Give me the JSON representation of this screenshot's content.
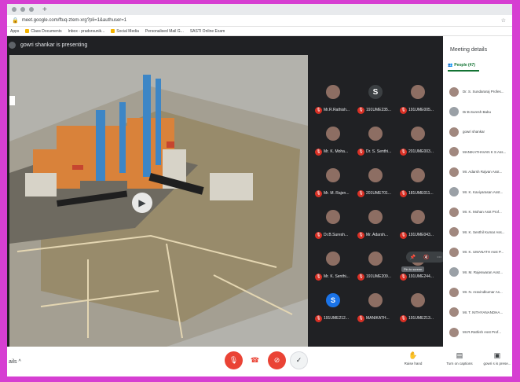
{
  "browser": {
    "url": "meet.google.com/ftuq-ztem-xrg?pli=1&authuser=1",
    "bookmarks": [
      "Apps",
      "Class Documents",
      "Inbox - pradsrsunik...",
      "Social Media",
      "Personalised Mail G...",
      "SASTI Online Exam"
    ]
  },
  "meeting": {
    "presenter_text": "gowri shankar is presenting"
  },
  "tiles": [
    {
      "name": "Mr.R.Rathish...",
      "avatar": "photo"
    },
    {
      "name": "191UME235...",
      "avatar": "letter",
      "letter": "S"
    },
    {
      "name": "191UME005...",
      "avatar": "photo"
    },
    {
      "name": "Mr. K. Moha...",
      "avatar": "photo"
    },
    {
      "name": "Dr. S. Senthi...",
      "avatar": "photo"
    },
    {
      "name": "201UME003...",
      "avatar": "photo"
    },
    {
      "name": "Mr. M. Rajen...",
      "avatar": "photo"
    },
    {
      "name": "201UME701...",
      "avatar": "photo"
    },
    {
      "name": "181UME011...",
      "avatar": "photo"
    },
    {
      "name": "Dr.B.Suresh...",
      "avatar": "photo"
    },
    {
      "name": "Mr. Adarsh...",
      "avatar": "photo"
    },
    {
      "name": "191UME043...",
      "avatar": "photo"
    },
    {
      "name": "Mr. K. Senthi...",
      "avatar": "photo"
    },
    {
      "name": "191UME209...",
      "avatar": "photo"
    },
    {
      "name": "191UME244...",
      "avatar": "photo"
    },
    {
      "name": "191UME212...",
      "avatar": "blue",
      "letter": "S"
    },
    {
      "name": "MANIKATH...",
      "avatar": "photo"
    },
    {
      "name": "191UME213...",
      "avatar": "photo"
    }
  ],
  "tooltip": "Pin to screen",
  "panel": {
    "title": "Meeting details",
    "people_tab": "People (47)",
    "people": [
      "Dr. S. Sundararaj Profes...",
      "Dr.B.Suresh Babu",
      "gowri shankar",
      "MANIKATHAVAN K S Ass...",
      "Mr. Adarsh Rajvan Asst...",
      "Mr. K. Kaviyarasan Asst...",
      "Mr. K. Mohan Asst Prof...",
      "Mr. K. Senthil Kumar Ass...",
      "Mr. K. UMANATH Asst P...",
      "Mr. M. Rajeswaran Asst...",
      "Mr. N. Aravindkumar As...",
      "Mr. T. NITHYANANDHA...",
      "Mr.R.Rathish Asst Prof..."
    ]
  },
  "bottom": {
    "left_label": "ails",
    "raise_hand": "Raise hand",
    "captions": "Turn on captions",
    "presenting": "gowri s is prese..."
  },
  "colors": {
    "frame": "#d63fd2",
    "meet_bg": "#202124",
    "end_red": "#ea4335",
    "people_green": "#137333"
  }
}
